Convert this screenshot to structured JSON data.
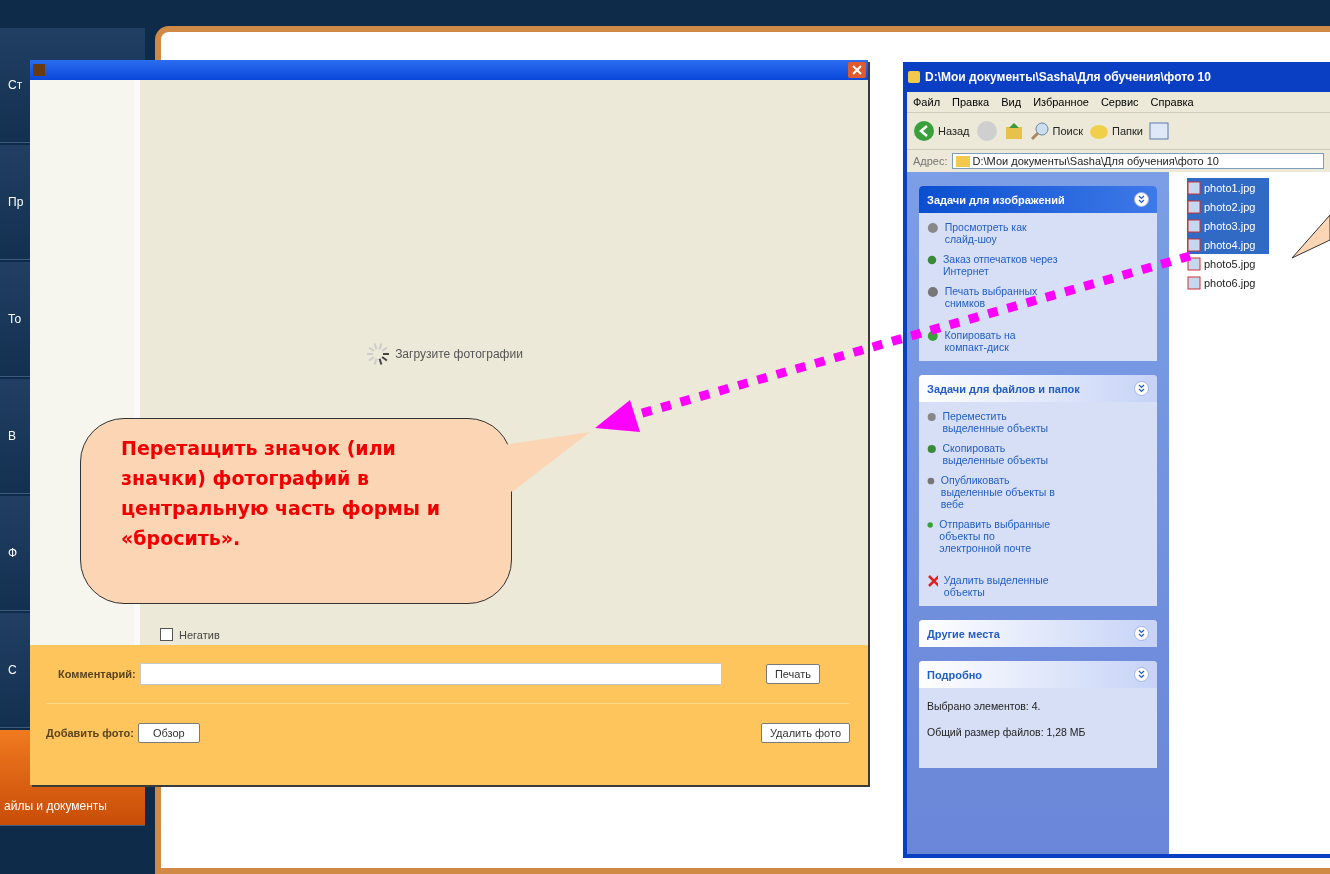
{
  "app_nav": {
    "items": [
      {
        "label": "Ст",
        "selected": false
      },
      {
        "label": "Пр",
        "selected": false
      },
      {
        "label": "То",
        "selected": false
      },
      {
        "label": "В",
        "selected": false
      },
      {
        "label": "Ф",
        "selected": false
      },
      {
        "label": "С",
        "selected": false
      },
      {
        "label": "айлы и документы",
        "selected": true
      }
    ]
  },
  "upload_dialog": {
    "status": "Загрузите фотографии",
    "negative": {
      "label": "Негатив",
      "checked": false
    },
    "comment_label": "Комментарий:",
    "print_button": "Печать",
    "add_photo_label": "Добавить фото:",
    "browse_button": "Обзор",
    "delete_button": "Удалить фото"
  },
  "explorer": {
    "title": "D:\\Мои документы\\Sasha\\Для обучения\\фото 10",
    "menu": [
      "Файл",
      "Правка",
      "Вид",
      "Избранное",
      "Сервис",
      "Справка"
    ],
    "toolbar": {
      "back": "Назад",
      "search": "Поиск",
      "folders": "Папки"
    },
    "address_label": "Адрес:",
    "address": "D:\\Мои документы\\Sasha\\Для обучения\\фото 10",
    "panes": [
      {
        "title": "Задачи для изображений",
        "kind": "picture",
        "items": [
          {
            "text": "Просмотреть как слайд-шоу"
          },
          {
            "text": "Заказ отпечатков через Интернет"
          },
          {
            "text": "Печать выбранных снимков"
          },
          {
            "text": "Копировать на компакт-диск"
          }
        ]
      },
      {
        "title": "Задачи для файлов и папок",
        "kind": "plain",
        "items": [
          {
            "text": "Переместить выделенные объекты"
          },
          {
            "text": "Скопировать выделенные объекты"
          },
          {
            "text": "Опубликовать выделенные объекты в вебе"
          },
          {
            "text": "Отправить выбранные объекты по электронной почте"
          },
          {
            "text": "Удалить выделенные объекты"
          }
        ]
      },
      {
        "title": "Другие места",
        "kind": "plain"
      },
      {
        "title": "Подробно",
        "kind": "details",
        "lines": [
          "Выбрано элементов: 4.",
          "Общий размер файлов: 1,28 МБ"
        ]
      }
    ],
    "files": [
      {
        "name": "photo1.jpg",
        "selected": true
      },
      {
        "name": "photo2.jpg",
        "selected": true
      },
      {
        "name": "photo3.jpg",
        "selected": true
      },
      {
        "name": "photo4.jpg",
        "selected": true
      },
      {
        "name": "photo5.jpg",
        "selected": false
      },
      {
        "name": "photo6.jpg",
        "selected": false
      }
    ]
  },
  "callout": {
    "text": "Перетащить значок (или значки) фотографий в центральную часть формы и «бросить»."
  }
}
